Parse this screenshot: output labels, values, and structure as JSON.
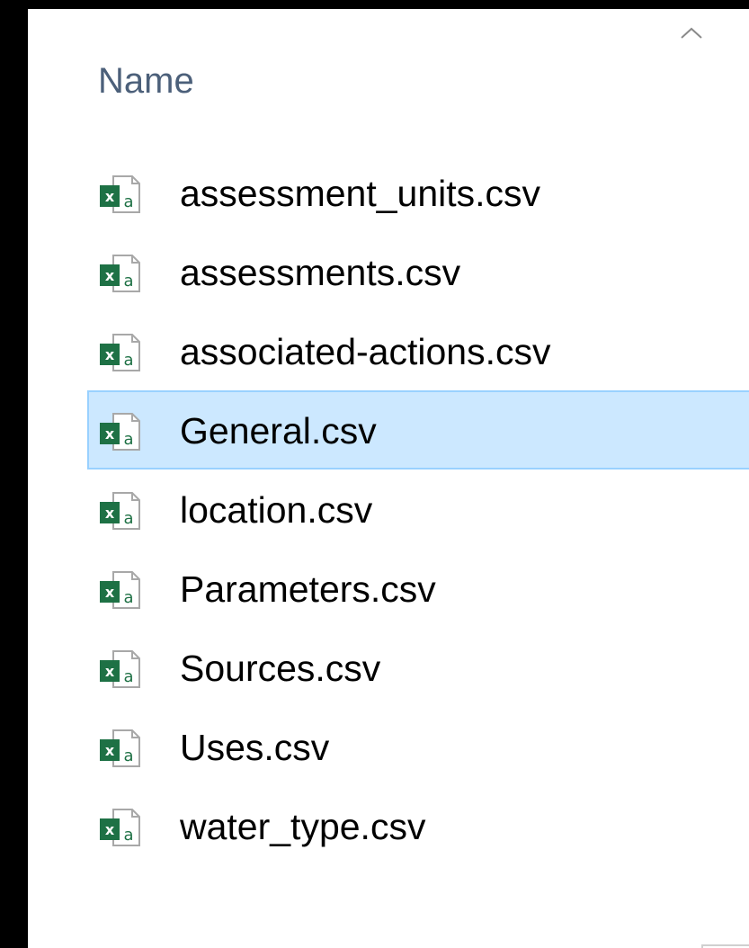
{
  "column": {
    "name_label": "Name",
    "sort_icon": "chevron-up-icon"
  },
  "file_icon": "excel-csv-icon",
  "selected_color": "#cce8ff",
  "files": [
    {
      "name": "assessment_units.csv",
      "selected": false
    },
    {
      "name": "assessments.csv",
      "selected": false
    },
    {
      "name": "associated-actions.csv",
      "selected": false
    },
    {
      "name": "General.csv",
      "selected": true
    },
    {
      "name": "location.csv",
      "selected": false
    },
    {
      "name": "Parameters.csv",
      "selected": false
    },
    {
      "name": "Sources.csv",
      "selected": false
    },
    {
      "name": "Uses.csv",
      "selected": false
    },
    {
      "name": "water_type.csv",
      "selected": false
    }
  ]
}
